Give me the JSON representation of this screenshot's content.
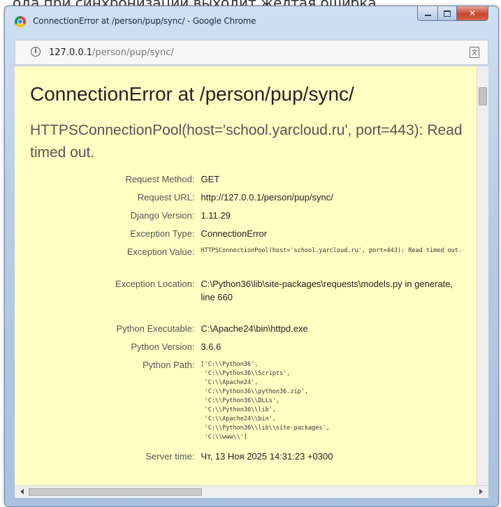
{
  "top_text": "ода при синхронизации выходит желтая ошибка",
  "window": {
    "title": "ConnectionError at /person/pup/sync/ - Google Chrome",
    "controls": {
      "close_glyph": "✕"
    }
  },
  "addressbar": {
    "url_host": "127.0.0.1",
    "url_path": "/person/pup/sync/",
    "info_glyph": "i",
    "translate_glyph": "文"
  },
  "page": {
    "title": "ConnectionError at /person/pup/sync/",
    "subtitle": "HTTPSConnectionPool(host='school.yarcloud.ru', port=443): Read timed out.",
    "meta": [
      {
        "label": "Request Method:",
        "value": "GET"
      },
      {
        "label": "Request URL:",
        "value": "http://127.0.0.1/person/pup/sync/"
      },
      {
        "label": "Django Version:",
        "value": "1.11.29"
      },
      {
        "label": "Exception Type:",
        "value": "ConnectionError"
      },
      {
        "label": "Exception Value:",
        "value": "HTTPSConnectionPool(host='school.yarcloud.ru', port=443): Read timed out."
      },
      {
        "label": "Exception Location:",
        "value": "C:\\Python36\\lib\\site-packages\\requests\\models.py in generate, line 660"
      },
      {
        "label": "Python Executable:",
        "value": "C:\\Apache24\\bin\\httpd.exe"
      },
      {
        "label": "Python Version:",
        "value": "3.6.6"
      },
      {
        "label": "Python Path:",
        "value": "['C:\\\\Python36',\n 'C:\\\\Python36\\\\Scripts',\n 'C:\\\\Apache24',\n 'C:\\\\Python36\\\\python36.zip',\n 'C:\\\\Python36\\\\DLLs',\n 'C:\\\\Python36\\\\lib',\n 'C:\\\\Apache24\\\\bin',\n 'C:\\\\Python36\\\\lib\\\\site-packages',\n 'C:\\\\www\\\\']"
      },
      {
        "label": "Server time:",
        "value": "Чт, 13 Ноя 2025 14:31:23 +0300"
      }
    ]
  }
}
